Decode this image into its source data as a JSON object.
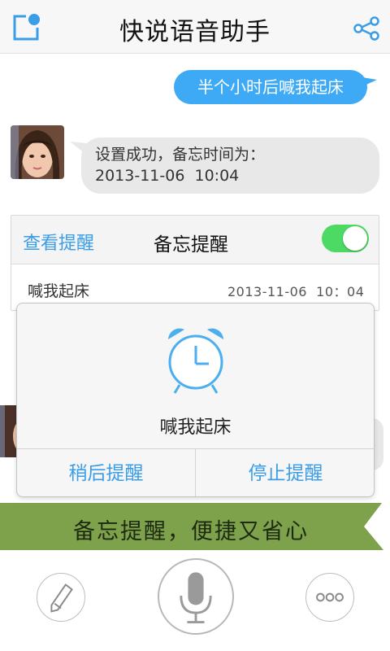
{
  "header": {
    "title": "快说语音助手",
    "compose_icon": "compose-icon",
    "share_icon": "share-icon"
  },
  "chat": {
    "user_message": "半个小时后喊我起床",
    "bot_reply": {
      "line1": "设置成功，备忘时间为：",
      "line2": "2013-11-06  10:04"
    }
  },
  "reminder_card": {
    "view_link": "查看提醒",
    "title": "备忘提醒",
    "toggle_on": true,
    "item": {
      "name": "喊我起床",
      "time": "2013-11-06  10：04"
    }
  },
  "alarm_popup": {
    "icon": "alarm-clock-icon",
    "message": "喊我起床",
    "snooze_label": "稍后提醒",
    "stop_label": "停止提醒"
  },
  "banner": {
    "text": "备忘提醒，便捷又省心"
  },
  "bottom_bar": {
    "left_icon": "pencil-icon",
    "center_icon": "microphone-icon",
    "right_icon": "more-icon"
  },
  "colors": {
    "accent_blue": "#3eaaf5",
    "link_blue": "#3a9de8",
    "toggle_green": "#4cd964",
    "banner_green": "#7ea14c"
  }
}
